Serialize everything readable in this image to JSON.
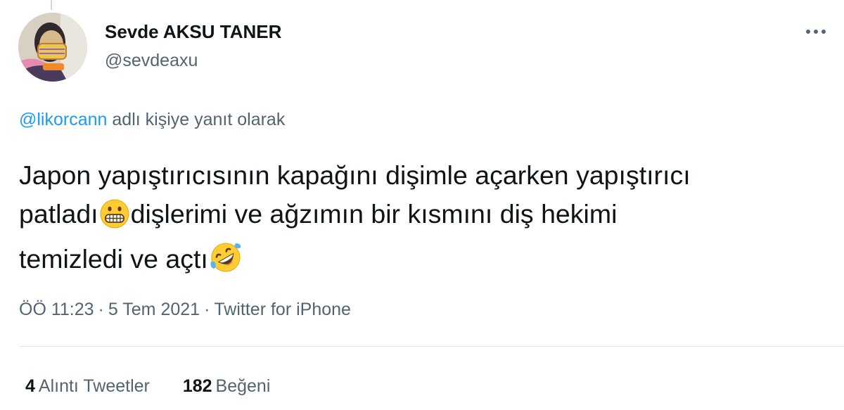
{
  "author": {
    "display_name": "Sevde AKSU TANER",
    "handle": "@sevdeaxu"
  },
  "reply": {
    "mention": "@likorcann",
    "suffix": "adlı kişiye yanıt olarak"
  },
  "tweet": {
    "line1": "Japon yapıştırıcısının kapağını dişimle açarken yapıştırıcı",
    "line2a": "patladı",
    "line2b": "dişlerimi ve ağzımın bir kısmını diş hekimi",
    "line3": "temizledi ve açtı",
    "emojis": [
      "grimacing-face-emoji",
      "rolling-on-floor-laughing-emoji"
    ]
  },
  "meta": {
    "time": "ÖÖ 11:23",
    "separator": "·",
    "date": "5 Tem 2021",
    "source": "Twitter for iPhone"
  },
  "stats": {
    "quotes_count": "4",
    "quotes_label": "Alıntı Tweetler",
    "likes_count": "182",
    "likes_label": "Beğeni"
  },
  "icons": {
    "more": "more-dots-icon"
  },
  "colors": {
    "link": "#1d9bf0",
    "secondary_text": "#536471",
    "primary_text": "#0f1419",
    "divider": "#e1e8ed"
  }
}
